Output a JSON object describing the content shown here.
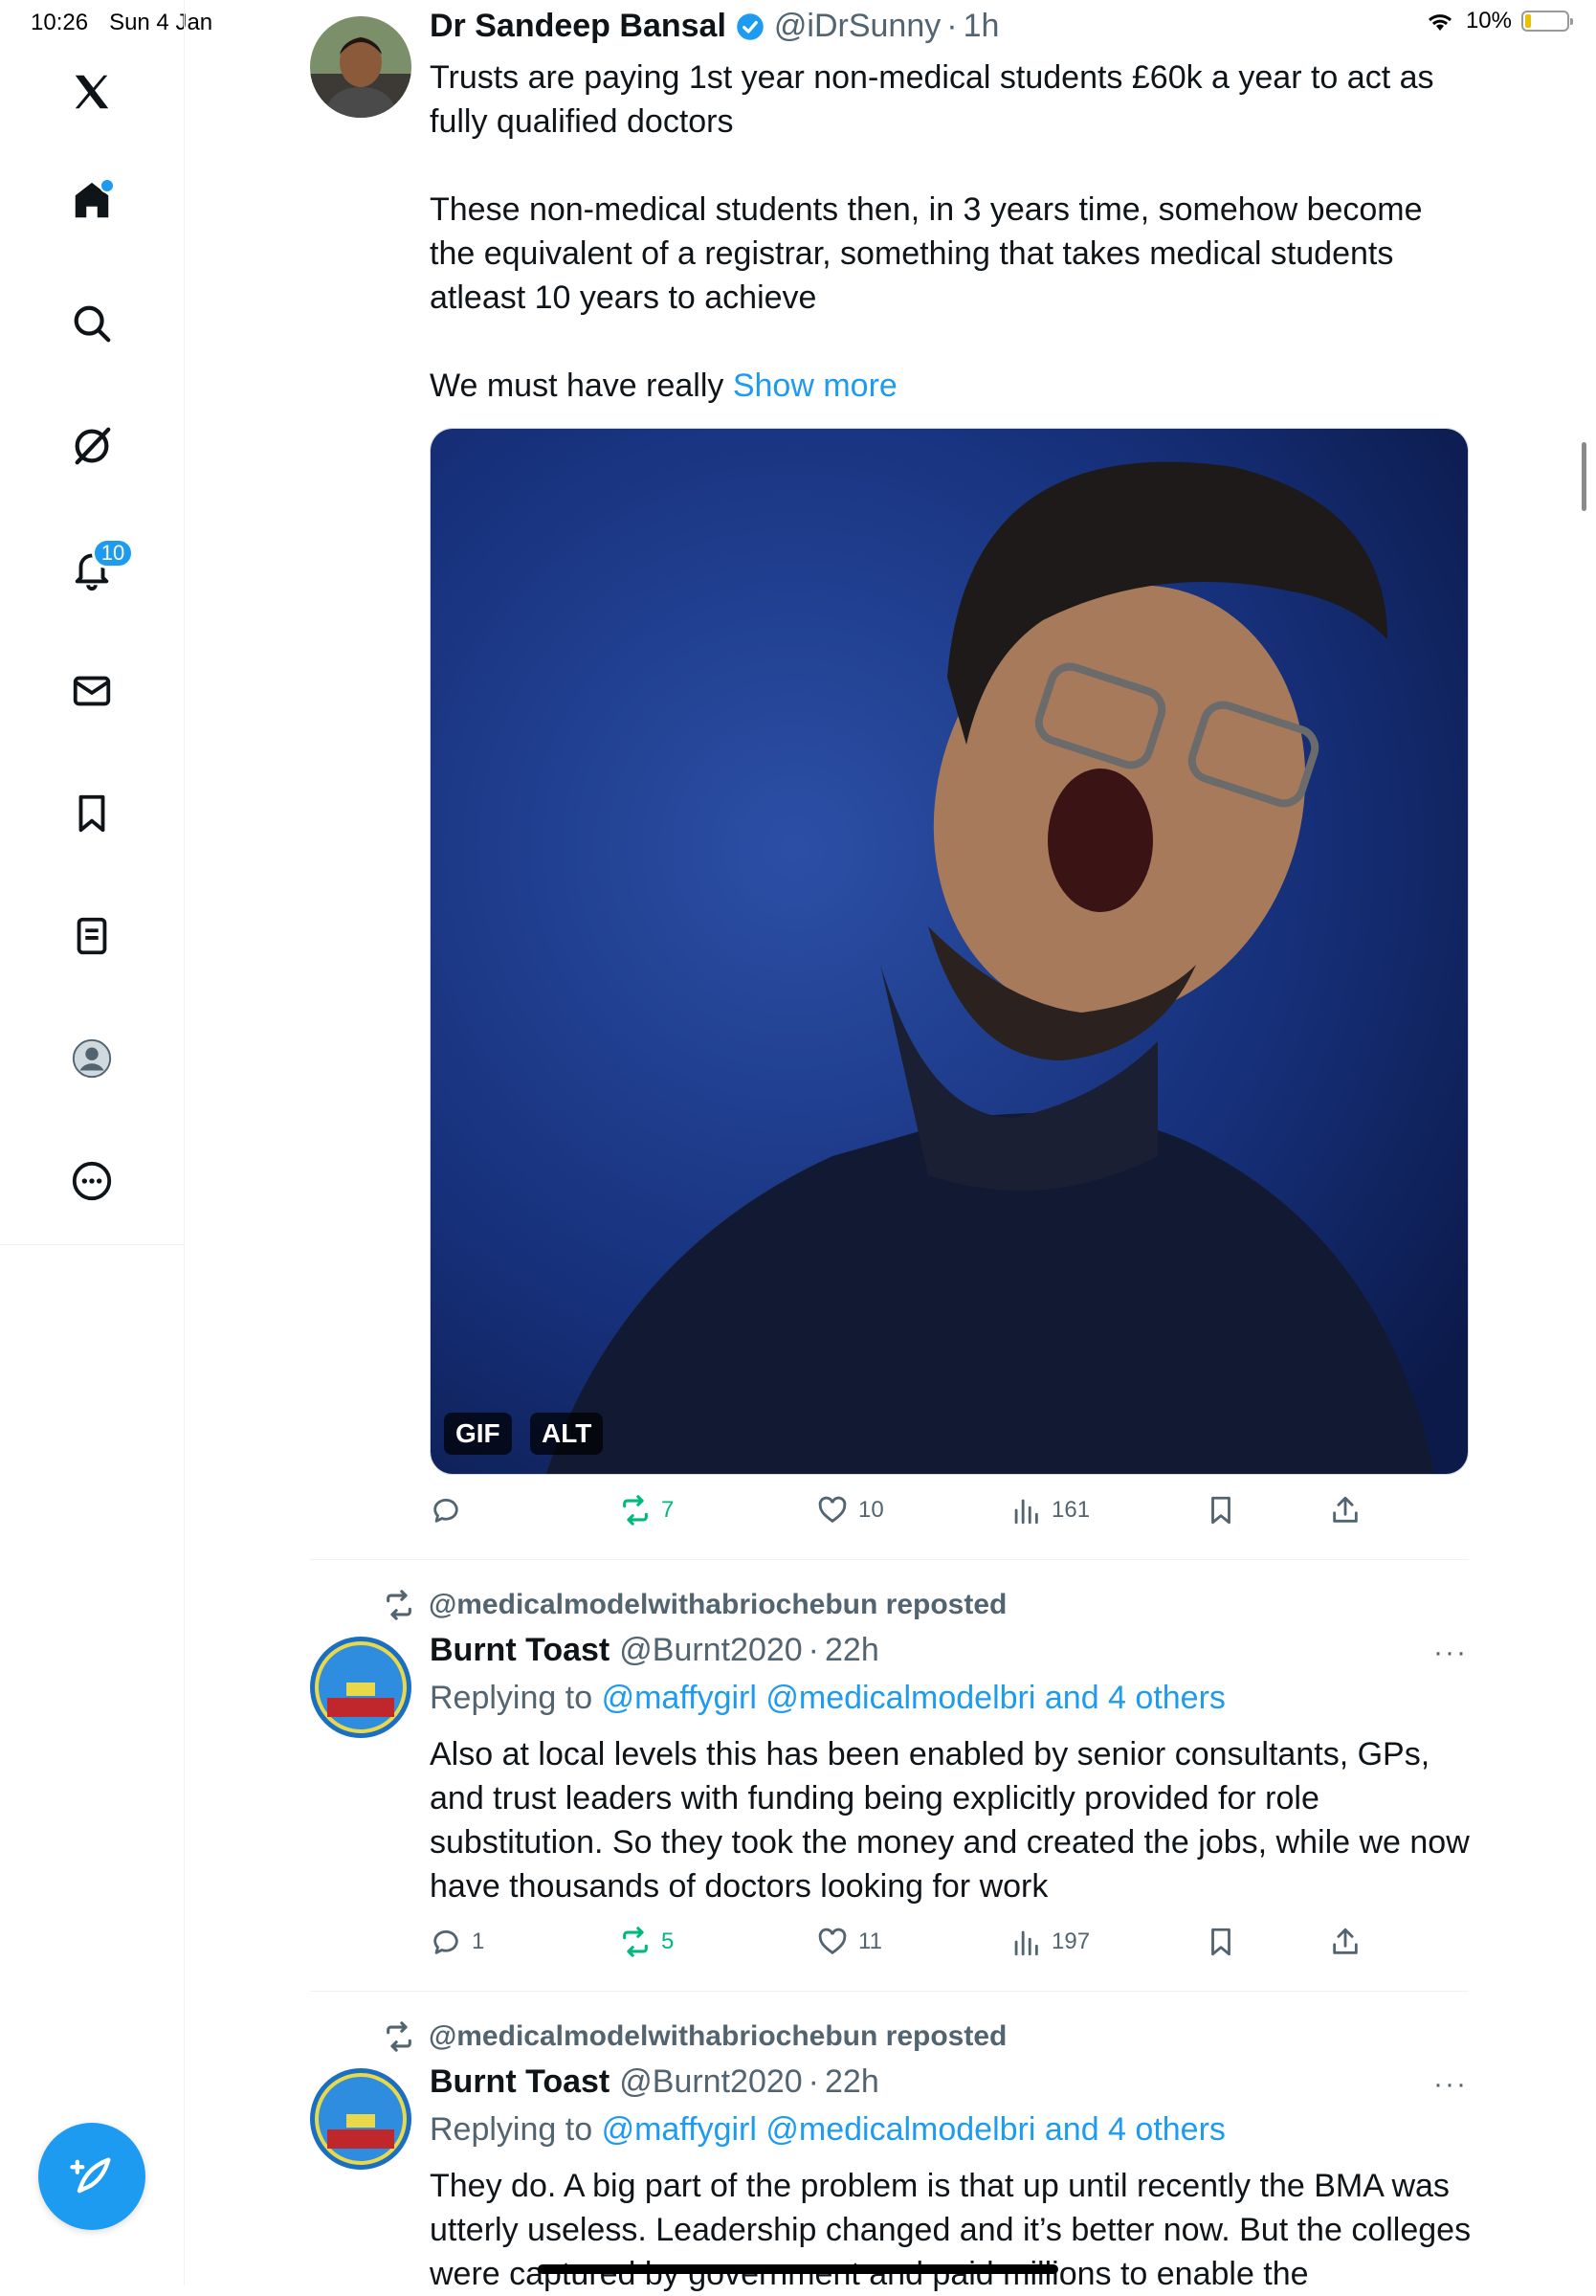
{
  "status_bar": {
    "time": "10:26",
    "date": "Sun 4 Jan",
    "battery": "10%"
  },
  "sidebar": {
    "items": [
      {
        "name": "x-logo-icon"
      },
      {
        "name": "home-icon"
      },
      {
        "name": "search-icon"
      },
      {
        "name": "grok-icon"
      },
      {
        "name": "notifications-icon",
        "badge": "10"
      },
      {
        "name": "messages-icon"
      },
      {
        "name": "bookmarks-icon"
      },
      {
        "name": "lists-icon"
      },
      {
        "name": "profile-icon"
      },
      {
        "name": "more-icon"
      }
    ],
    "compose": "compose-icon"
  },
  "post1": {
    "author": "Dr Sandeep Bansal",
    "handle": "@iDrSunny",
    "sep": "·",
    "time": "1h",
    "text_p1": "Trusts are paying 1st year non-medical students £60k a year to act as fully qualified doctors",
    "text_p2": "These non-medical students then, in 3 years time, somehow become the equivalent of a registrar, something that takes medical students atleast 10 years to achieve",
    "text_p3": "We must have really",
    "show_more": "Show more",
    "media_tags": {
      "gif": "GIF",
      "alt": "ALT"
    },
    "stats": {
      "replies": "",
      "reposts": "7",
      "likes": "10",
      "views": "161"
    }
  },
  "post2": {
    "reposted_by": "@medicalmodelwithabriochebun reposted",
    "author": "Burnt Toast",
    "handle": "@Burnt2020",
    "sep": "·",
    "time": "22h",
    "replying_label": "Replying to",
    "replying_targets": "@maffygirl @medicalmodelbri and 4 others",
    "text": "Also at local levels this has been enabled by senior consultants, GPs, and trust leaders with funding being explicitly provided for role substitution. So they took the money and created the jobs, while we now have thousands of doctors looking for work",
    "stats": {
      "replies": "1",
      "reposts": "5",
      "likes": "11",
      "views": "197"
    },
    "more": "···"
  },
  "post3": {
    "reposted_by": "@medicalmodelwithabriochebun reposted",
    "author": "Burnt Toast",
    "handle": "@Burnt2020",
    "sep": "·",
    "time": "22h",
    "replying_label": "Replying to",
    "replying_targets": "@maffygirl @medicalmodelbri and 4 others",
    "text": "They do. A big part of the problem is that up until recently the BMA was utterly useless. Leadership changed and it’s better now. But the colleges were captured by government and paid millions to enable the",
    "more": "···"
  },
  "colors": {
    "accent": "#1d9bf0",
    "repost_green": "#00ba7c",
    "muted": "#536471"
  }
}
